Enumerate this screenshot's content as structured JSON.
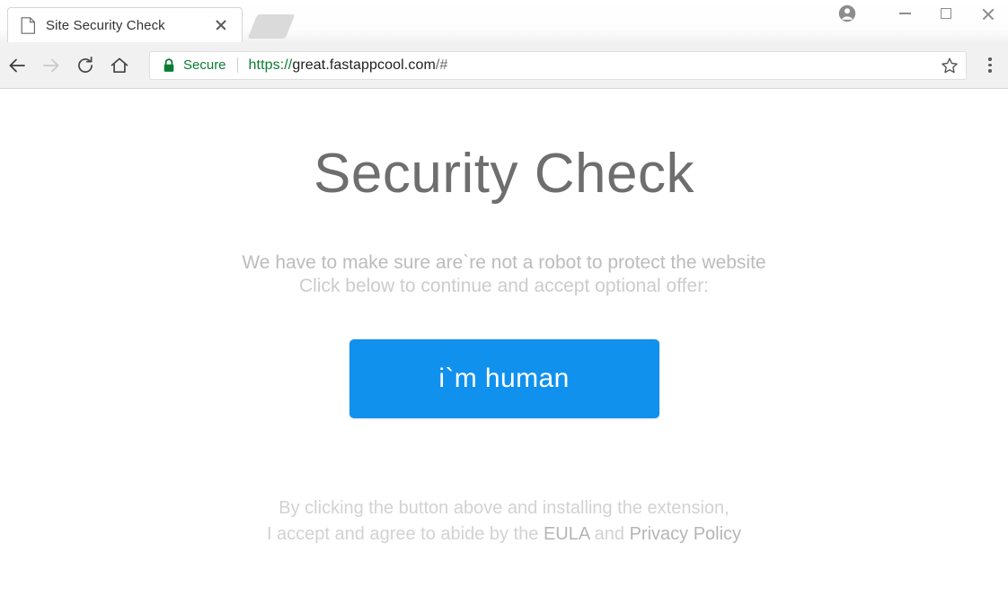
{
  "window": {
    "controls": {
      "avatar": "profile-avatar-icon",
      "minimize": "minimize-icon",
      "maximize": "maximize-icon",
      "close": "close-icon"
    }
  },
  "tabstrip": {
    "tabs": [
      {
        "title": "Site Security Check",
        "favicon": "page-icon",
        "close": "close-icon",
        "active": true
      }
    ],
    "new_tab_label": "new-tab-button"
  },
  "toolbar": {
    "back": "back-arrow-icon",
    "forward": "forward-arrow-icon",
    "reload": "reload-icon",
    "home": "home-icon",
    "bookmark": "star-icon",
    "menu": "three-dot-menu-icon",
    "omnibox": {
      "lock": "lock-icon",
      "security_label": "Secure",
      "url_scheme": "https://",
      "url_host": "great.fastappcool.com",
      "url_path": "/#",
      "url_full": "https://great.fastappcool.com/#"
    }
  },
  "page": {
    "title": "Security Check",
    "subtext_line1": "We have to make sure are`re not a robot to protect the website",
    "subtext_line2": "Click below to continue and accept optional offer:",
    "cta_label": "i`m human",
    "footnote_line1": "By clicking the button above and installing the extension,",
    "footnote_line2_pre": "I accept and agree to abide by the ",
    "footnote_eula": "EULA",
    "footnote_line2_mid": " and ",
    "footnote_privacy": "Privacy Policy"
  },
  "colors": {
    "cta_blue": "#1191ee",
    "secure_green": "#0b7c33",
    "title_gray": "#6e6e6e",
    "toolbar_gray": "#f1f1f1"
  }
}
